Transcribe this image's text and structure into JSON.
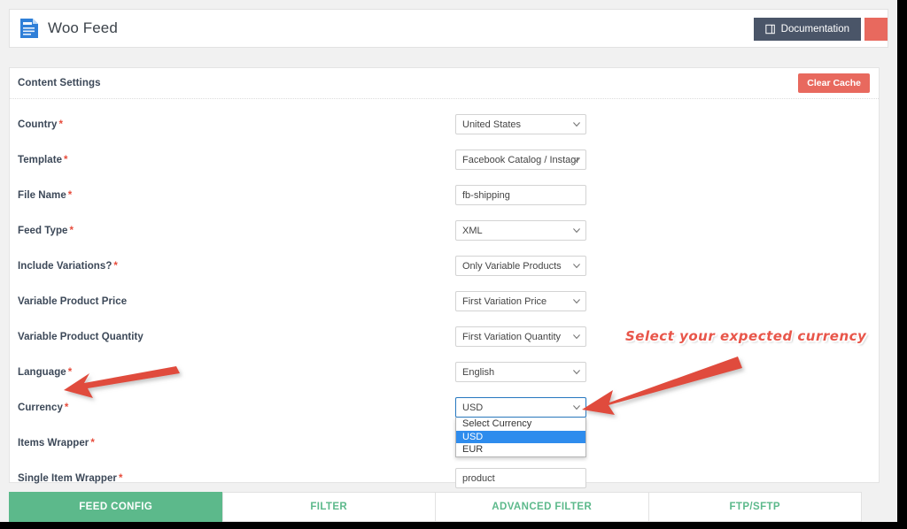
{
  "window": {
    "app_title": "Woo Feed",
    "app_icon": "document-form-icon"
  },
  "header": {
    "documentation_label": "Documentation",
    "documentation_icon": "book-icon",
    "secondary_button_label": ""
  },
  "panel": {
    "title": "Content Settings",
    "clear_cache_label": "Clear Cache"
  },
  "form": {
    "required_marker": "*",
    "rows": [
      {
        "label": "Country",
        "required": true,
        "type": "select",
        "value": "United States",
        "name": "country"
      },
      {
        "label": "Template",
        "required": true,
        "type": "select",
        "value": "Facebook Catalog / Instagr",
        "name": "template"
      },
      {
        "label": "File Name",
        "required": true,
        "type": "text",
        "value": "fb-shipping",
        "name": "file-name"
      },
      {
        "label": "Feed Type",
        "required": true,
        "type": "select",
        "value": "XML",
        "name": "feed-type"
      },
      {
        "label": "Include Variations?",
        "required": true,
        "type": "select",
        "value": "Only Variable Products",
        "name": "include-variations"
      },
      {
        "label": "Variable Product Price",
        "required": false,
        "type": "select",
        "value": "First Variation Price",
        "name": "variable-product-price"
      },
      {
        "label": "Variable Product Quantity",
        "required": false,
        "type": "select",
        "value": "First Variation Quantity",
        "name": "variable-product-quantity"
      },
      {
        "label": "Language",
        "required": true,
        "type": "select",
        "value": "English",
        "name": "language"
      },
      {
        "label": "Currency",
        "required": true,
        "type": "select-open",
        "value": "USD",
        "name": "currency",
        "options": [
          {
            "label": "Select Currency",
            "selected": false
          },
          {
            "label": "USD",
            "selected": true
          },
          {
            "label": "EUR",
            "selected": false
          }
        ]
      },
      {
        "label": "Items Wrapper",
        "required": true,
        "type": "hidden-field",
        "value": "",
        "name": "items-wrapper"
      },
      {
        "label": "Single Item Wrapper",
        "required": true,
        "type": "text",
        "value": "product",
        "name": "single-item-wrapper"
      }
    ]
  },
  "tabs": [
    {
      "label": "FEED CONFIG",
      "active": true
    },
    {
      "label": "FILTER",
      "active": false
    },
    {
      "label": "ADVANCED FILTER",
      "active": false
    },
    {
      "label": "FTP/SFTP",
      "active": false
    }
  ],
  "annotations": {
    "note_text": "Select your expected currency",
    "arrow_to_label": "arrow-pointing-left-to-currency-label",
    "arrow_to_dropdown": "arrow-pointing-left-to-currency-dropdown"
  },
  "colors": {
    "accent_green": "#5cb98b",
    "danger_red": "#e8695e",
    "annotation_red": "#e8564a",
    "dark_slate": "#4a5568",
    "select_highlight_blue": "#2e8ced",
    "focus_blue": "#2a7ac0",
    "page_bg": "#f1f1f1"
  }
}
